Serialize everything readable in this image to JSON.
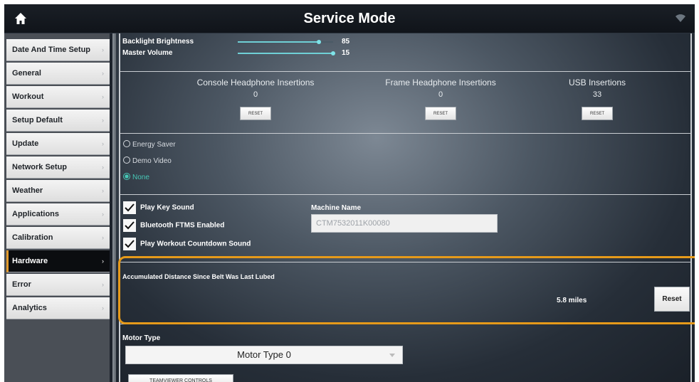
{
  "header": {
    "title": "Service Mode",
    "home_icon": "home-icon",
    "wifi_icon": "wifi-icon"
  },
  "sidebar": {
    "items": [
      {
        "label": "Date And Time Setup",
        "chevron": "›"
      },
      {
        "label": "General",
        "chevron": "›"
      },
      {
        "label": "Workout",
        "chevron": "›"
      },
      {
        "label": "Setup Default",
        "chevron": "›"
      },
      {
        "label": "Update",
        "chevron": "›"
      },
      {
        "label": "Network Setup",
        "chevron": "›"
      },
      {
        "label": "Weather",
        "chevron": "›"
      },
      {
        "label": "Applications",
        "chevron": "›"
      },
      {
        "label": "Calibration",
        "chevron": "›"
      },
      {
        "label": "Hardware",
        "chevron": "›",
        "active": true
      },
      {
        "label": "Error",
        "chevron": "›"
      },
      {
        "label": "Analytics",
        "chevron": "›"
      }
    ],
    "active_accent": "#e39a2c"
  },
  "sliders": {
    "backlight": {
      "label": "Backlight Brightness",
      "value": "85",
      "level": 0.85
    },
    "volume": {
      "label": "Master Volume",
      "value": "15",
      "level": 1.0
    }
  },
  "insertions": [
    {
      "title": "Console Headphone Insertions",
      "value": "0",
      "button": "RESET"
    },
    {
      "title": "Frame Headphone Insertions",
      "value": "0",
      "button": "RESET"
    },
    {
      "title": "USB Insertions",
      "value": "33",
      "button": "RESET"
    }
  ],
  "modes": [
    {
      "label": "Energy Saver",
      "selected": false
    },
    {
      "label": "Demo Video",
      "selected": false
    },
    {
      "label": "None",
      "selected": true
    }
  ],
  "checkboxes": [
    {
      "label": "Play Key Sound",
      "checked": true
    },
    {
      "label": "Bluetooth FTMS Enabled",
      "checked": true
    },
    {
      "label": "Play Workout Countdown Sound",
      "checked": true
    }
  ],
  "machine": {
    "label": "Machine Name",
    "value": "CTM7532011K00080"
  },
  "belt": {
    "label": "Accumulated Distance Since Belt Was Last Lubed",
    "distance": "5.8 miles",
    "reset_label": "Reset",
    "highlight_color": "#e69a1a"
  },
  "motor": {
    "label": "Motor Type",
    "selected": "Motor Type 0",
    "dropdown_icon": "chevron-down-icon"
  },
  "teamviewer": {
    "button_label": "TEAMVIEWER CONTROLS"
  }
}
